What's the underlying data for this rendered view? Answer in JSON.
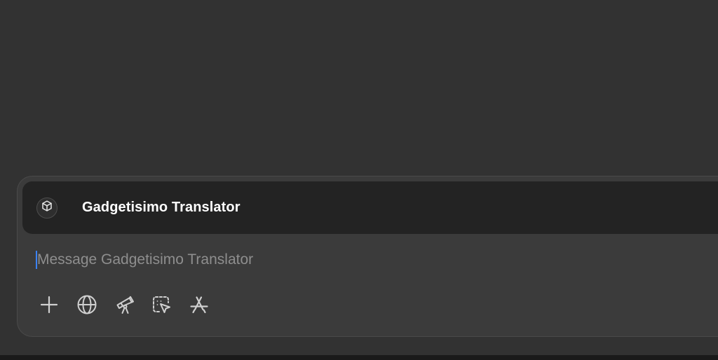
{
  "composer": {
    "gpt": {
      "name": "Gadgetisimo Translator",
      "icon": "cube-icon"
    },
    "message": {
      "value": "",
      "placeholder": "Message Gadgetisimo Translator"
    },
    "toolbar": [
      {
        "name": "add-button",
        "icon": "plus-icon"
      },
      {
        "name": "web-search-button",
        "icon": "globe-icon"
      },
      {
        "name": "deep-research-button",
        "icon": "telescope-icon"
      },
      {
        "name": "canvas-button",
        "icon": "select-pointer-icon"
      },
      {
        "name": "tools-button",
        "icon": "app-store-icon"
      }
    ]
  },
  "colors": {
    "background": "#323232",
    "composer": "#3b3b3b",
    "header": "#232323",
    "caret": "#3b82f6",
    "placeholder": "#8e8e8e",
    "icon": "#d0d0d0"
  }
}
